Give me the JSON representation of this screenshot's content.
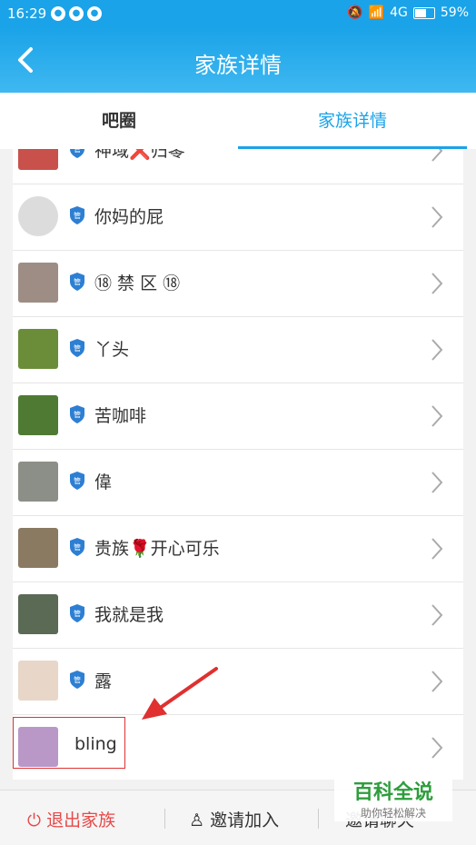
{
  "status": {
    "time": "16:29",
    "network": "4G",
    "battery": "59%"
  },
  "nav": {
    "title": "家族详情"
  },
  "tabs": [
    {
      "label": "吧圈"
    },
    {
      "label": "家族详情"
    }
  ],
  "members": [
    {
      "name": "神域❌归零",
      "avatar_color": "#c9514b"
    },
    {
      "name": "你妈的屁",
      "avatar_color": "#dcdcdc"
    },
    {
      "name": "⑱ 禁 区 ⑱",
      "avatar_color": "#9e8d84"
    },
    {
      "name": "丫头",
      "avatar_color": "#6b8d3a"
    },
    {
      "name": "苦咖啡",
      "avatar_color": "#4f7a33"
    },
    {
      "name": "偉",
      "avatar_color": "#8c8f87"
    },
    {
      "name": "贵族🌹开心可乐",
      "avatar_color": "#8a7a62"
    },
    {
      "name": "我就是我",
      "avatar_color": "#5b6a55"
    },
    {
      "name": "露",
      "avatar_color": "#e8d6c9"
    },
    {
      "name": "bling",
      "avatar_color": "#b998c8"
    }
  ],
  "badge_label": "管",
  "bottom": {
    "quit": "退出家族",
    "invite": "邀请加入",
    "invite_chat": "邀请聊天"
  },
  "watermark": {
    "title": "百科全说",
    "subtitle": "助你轻松解决"
  },
  "colors": {
    "primary": "#1aa3e8",
    "danger": "#e84848"
  }
}
